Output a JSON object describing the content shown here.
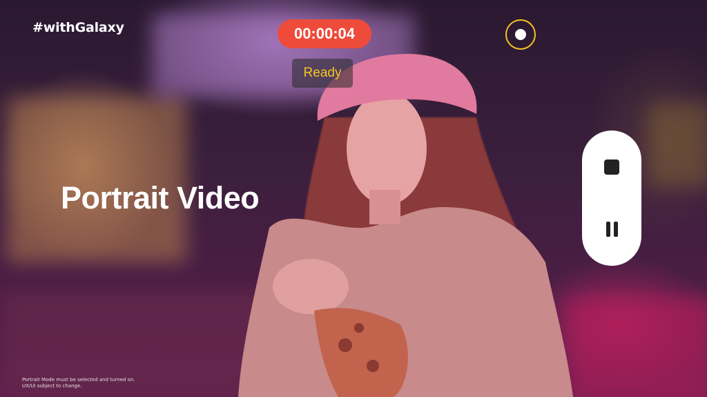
{
  "overlay": {
    "hashtag": "#withGalaxy",
    "timer": "00:00:04",
    "status": "Ready",
    "mode_title": "Portrait Video",
    "disclaimer_line1": "Portrait Mode must be selected and turned on.",
    "disclaimer_line2": "UX/UI subject to change."
  },
  "controls": {
    "capture_icon": "record-dot-icon",
    "stop_icon": "stop-icon",
    "pause_icon": "pause-icon"
  },
  "colors": {
    "timer_bg": "#ee4b3a",
    "status_text": "#f4c522",
    "capture_ring": "#f4c522",
    "panel_bg": "#ffffff"
  }
}
